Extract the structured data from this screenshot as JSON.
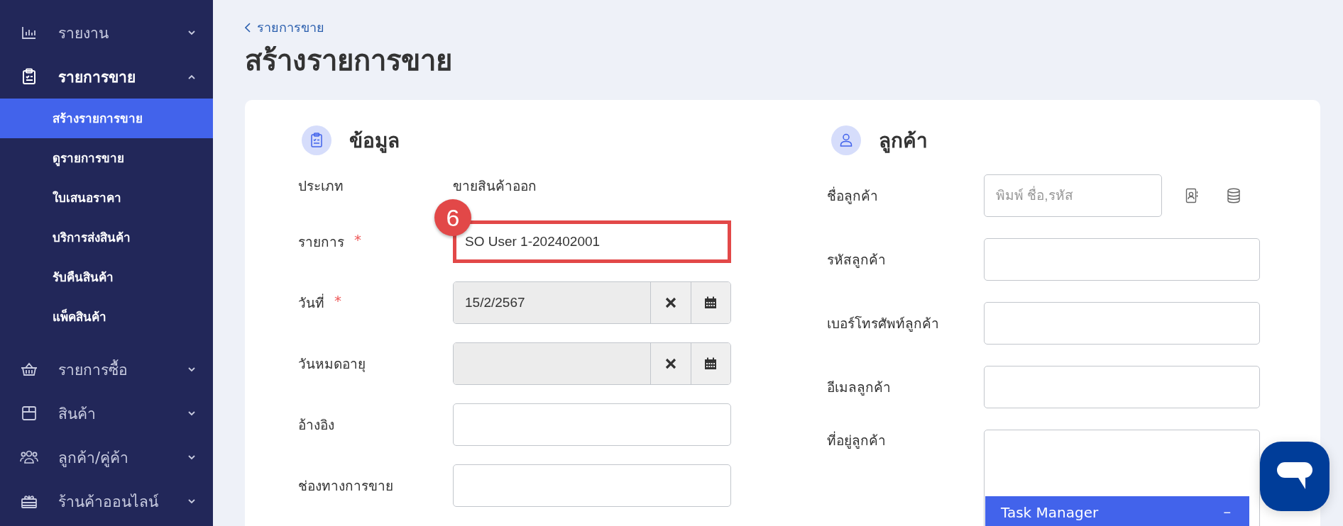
{
  "sidebar": {
    "items": [
      {
        "label": "รายงาน",
        "expanded": false
      },
      {
        "label": "รายการขาย",
        "expanded": true,
        "children": [
          {
            "label": "สร้างรายการขาย",
            "selected": true
          },
          {
            "label": "ดูรายการขาย",
            "selected": false
          },
          {
            "label": "ใบเสนอราคา",
            "selected": false
          },
          {
            "label": "บริการส่งสินค้า",
            "selected": false
          },
          {
            "label": "รับคืนสินค้า",
            "selected": false
          },
          {
            "label": "แพ็คสินค้า",
            "selected": false
          }
        ]
      },
      {
        "label": "รายการซื้อ",
        "expanded": false
      },
      {
        "label": "สินค้า",
        "expanded": false
      },
      {
        "label": "ลูกค้า/คู่ค้า",
        "expanded": false
      },
      {
        "label": "ร้านค้าออนไลน์",
        "expanded": false
      }
    ]
  },
  "breadcrumb": {
    "back_label": "รายการขาย"
  },
  "title": "สร้างรายการขาย",
  "sections": [
    {
      "title": "ข้อมูล",
      "rows": [
        {
          "kind": "static",
          "label": "ประเภท",
          "value": "ขายสินค้าออก"
        },
        {
          "kind": "text",
          "label": "รายการ",
          "required_mark": "*",
          "value": "SO User 1-202402001",
          "highlighted": true,
          "callout": "6"
        },
        {
          "kind": "date",
          "label": "วันที่",
          "required_mark": "*",
          "value": "15/2/2567",
          "readonly": true
        },
        {
          "kind": "date",
          "label": "วันหมดอายุ",
          "readonly": true
        },
        {
          "kind": "text",
          "label": "อ้างอิง"
        },
        {
          "kind": "text",
          "label": "ช่องทางการขาย"
        }
      ]
    },
    {
      "title": "ลูกค้า",
      "rows": [
        {
          "kind": "search",
          "label": "ชื่อลูกค้า",
          "placeholder": "พิมพ์ ชื่อ,รหัส"
        },
        {
          "kind": "text",
          "label": "รหัสลูกค้า"
        },
        {
          "kind": "text",
          "label": "เบอร์โทรศัพท์ลูกค้า"
        },
        {
          "kind": "text",
          "label": "อีเมลลูกค้า"
        },
        {
          "kind": "textarea",
          "label": "ที่อยู่ลูกค้า"
        }
      ]
    }
  ],
  "task_manager": {
    "title": "Task Manager",
    "minimize": "−"
  }
}
